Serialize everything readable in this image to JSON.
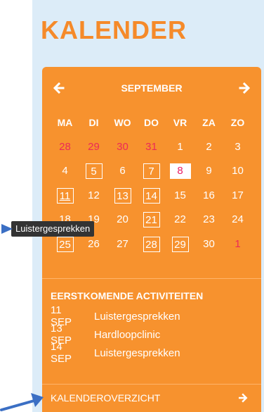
{
  "title": "KALENDER",
  "calendar": {
    "month": "SEPTEMBER",
    "weekdays": [
      "MA",
      "DI",
      "WO",
      "DO",
      "VR",
      "ZA",
      "ZO"
    ],
    "weeks": [
      [
        {
          "d": "28",
          "other": true
        },
        {
          "d": "29",
          "other": true
        },
        {
          "d": "30",
          "other": true
        },
        {
          "d": "31",
          "other": true
        },
        {
          "d": "1"
        },
        {
          "d": "2"
        },
        {
          "d": "3"
        }
      ],
      [
        {
          "d": "4"
        },
        {
          "d": "5",
          "event": true
        },
        {
          "d": "6"
        },
        {
          "d": "7",
          "event": true
        },
        {
          "d": "8",
          "today": true
        },
        {
          "d": "9"
        },
        {
          "d": "10"
        }
      ],
      [
        {
          "d": "11",
          "event": true,
          "underline": true
        },
        {
          "d": "12"
        },
        {
          "d": "13",
          "event": true
        },
        {
          "d": "14",
          "event": true
        },
        {
          "d": "15"
        },
        {
          "d": "16"
        },
        {
          "d": "17"
        }
      ],
      [
        {
          "d": "18"
        },
        {
          "d": "19"
        },
        {
          "d": "20"
        },
        {
          "d": "21",
          "event": true
        },
        {
          "d": "22"
        },
        {
          "d": "23"
        },
        {
          "d": "24"
        }
      ],
      [
        {
          "d": "25",
          "event": true
        },
        {
          "d": "26"
        },
        {
          "d": "27"
        },
        {
          "d": "28",
          "event": true
        },
        {
          "d": "29",
          "event": true
        },
        {
          "d": "30"
        },
        {
          "d": "1",
          "other": true
        }
      ]
    ]
  },
  "upcoming": {
    "heading": "EERSTKOMENDE ACTIVITEITEN",
    "items": [
      {
        "date": "11 SEP",
        "name": "Luistergesprekken"
      },
      {
        "date": "13 SEP",
        "name": "Hardloopclinic"
      },
      {
        "date": "14 SEP",
        "name": "Luistergesprekken"
      }
    ]
  },
  "overview_label": "KALENDEROVERZICHT",
  "tooltip": "Luistergesprekken",
  "icons": {
    "prev": "arrow-left-icon",
    "next": "arrow-right-icon",
    "overview": "arrow-right-icon"
  },
  "colors": {
    "accent": "#f7922e",
    "title": "#f58a2a",
    "panel_bg": "#dcecf8",
    "other_month": "#ec2a56",
    "today_text": "#e91e63",
    "annotation_arrow": "#3b6fc4"
  }
}
